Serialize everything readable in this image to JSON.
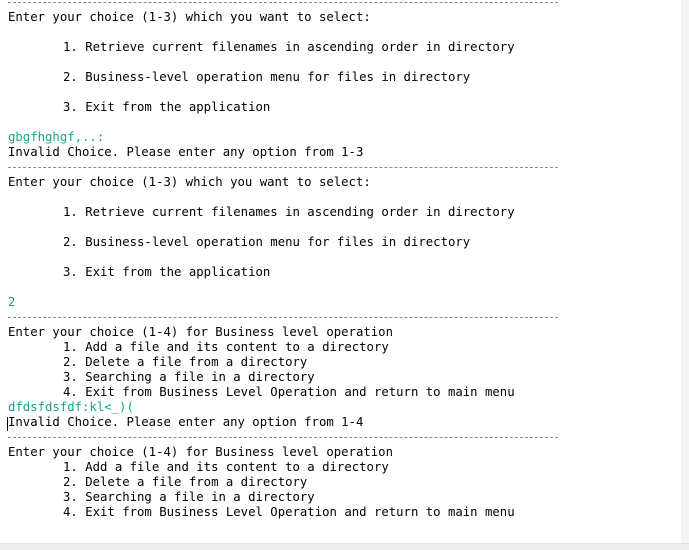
{
  "console": {
    "main_prompt": "Enter your choice (1-3) which you want to select:",
    "main_opt1": "1. Retrieve current filenames in ascending order in directory",
    "main_opt2": "2. Business-level operation menu for files in directory",
    "main_opt3": "3. Exit from the application",
    "input1": "gbgfhghgf,..:",
    "invalid_main": "Invalid Choice. Please enter any option from 1-3",
    "input2": "2",
    "biz_prompt": "Enter your choice (1-4) for Business level operation",
    "biz_opt1": "1. Add a file and its content to a directory",
    "biz_opt2": "2. Delete a file from a directory",
    "biz_opt3": "3. Searching a file in a directory",
    "biz_opt4": "4. Exit from Business Level Operation and return to main menu",
    "input3": "dfdsfdsfdf:kl<_)(",
    "invalid_biz": "Invalid Choice. Please enter any option from 1-4"
  },
  "colors": {
    "user_input": "#17a589",
    "output": "#000000",
    "separator": "#8a8a8a"
  }
}
